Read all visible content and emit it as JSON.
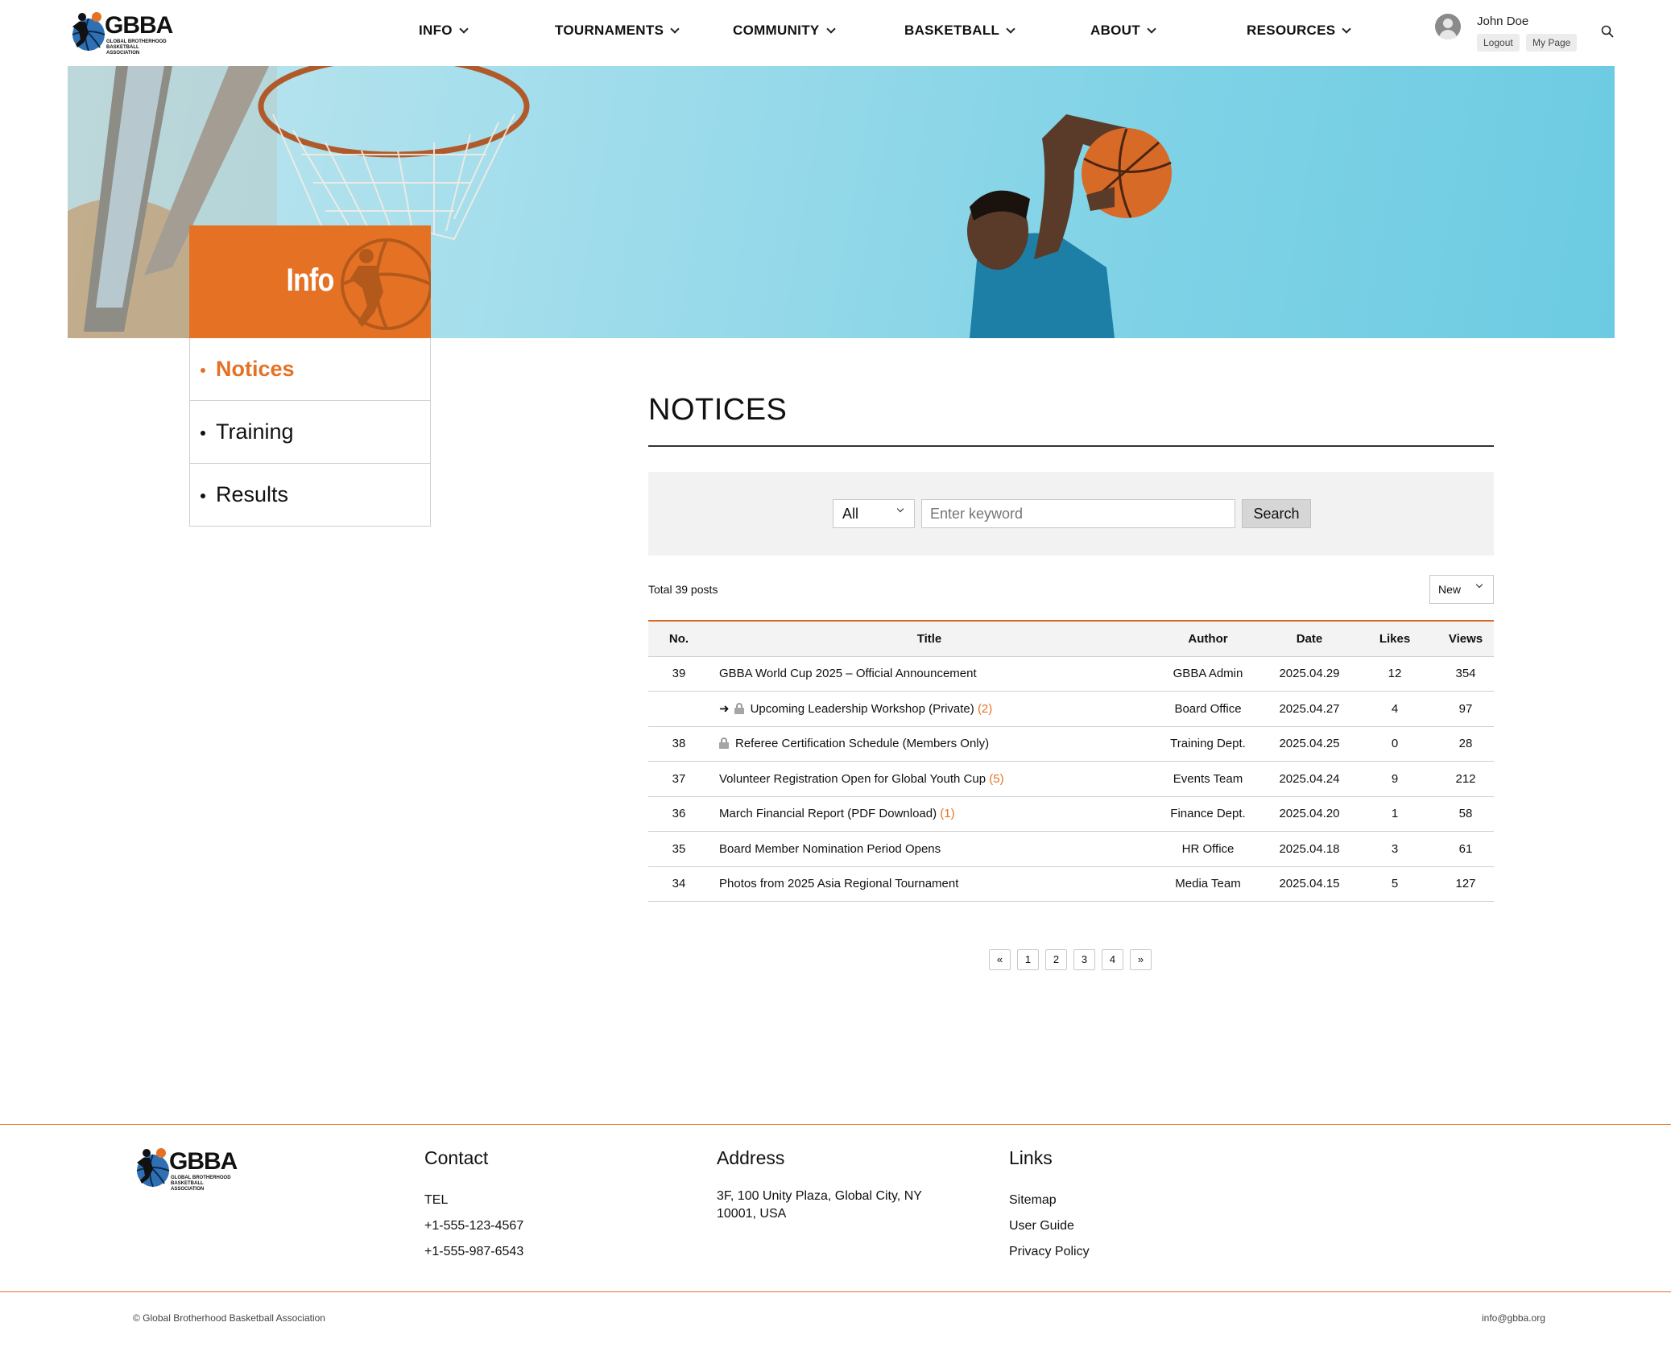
{
  "brand": {
    "logo_text": "GBBA",
    "logo_subtitle": "GLOBAL BROTHERHOOD BASKETBALL ASSOCIATION"
  },
  "nav": {
    "items": [
      {
        "label": "INFO"
      },
      {
        "label": "TOURNAMENTS"
      },
      {
        "label": "COMMUNITY"
      },
      {
        "label": "BASKETBALL"
      },
      {
        "label": "ABOUT"
      },
      {
        "label": "RESOURCES"
      }
    ]
  },
  "user": {
    "name": "John Doe",
    "logout_label": "Logout",
    "mypage_label": "My Page"
  },
  "hero": {
    "section_title": "Info"
  },
  "side_menu": {
    "items": [
      {
        "label": "Notices",
        "active": true
      },
      {
        "label": "Training",
        "active": false
      },
      {
        "label": "Results",
        "active": false
      }
    ]
  },
  "main": {
    "title": "NOTICES",
    "search": {
      "filter_value": "All",
      "keyword_placeholder": "Enter keyword",
      "button_label": "Search"
    },
    "total_text": "Total 39 posts",
    "sort_value": "New",
    "table": {
      "headers": {
        "no": "No.",
        "title": "Title",
        "author": "Author",
        "date": "Date",
        "likes": "Likes",
        "views": "Views"
      },
      "rows": [
        {
          "no": "39",
          "title": "GBBA World Cup 2025 – Official Announcement",
          "comments": "",
          "author": "GBBA Admin",
          "date": "2025.04.29",
          "likes": "12",
          "views": "354",
          "reply": false,
          "locked": false
        },
        {
          "no": "",
          "title": "Upcoming Leadership Workshop (Private)",
          "comments": "(2)",
          "author": "Board Office",
          "date": "2025.04.27",
          "likes": "4",
          "views": "97",
          "reply": true,
          "locked": true
        },
        {
          "no": "38",
          "title": "Referee Certification Schedule (Members Only)",
          "comments": "",
          "author": "Training Dept.",
          "date": "2025.04.25",
          "likes": "0",
          "views": "28",
          "reply": false,
          "locked": true
        },
        {
          "no": "37",
          "title": "Volunteer Registration Open for Global Youth Cup",
          "comments": "(5)",
          "author": "Events Team",
          "date": "2025.04.24",
          "likes": "9",
          "views": "212",
          "reply": false,
          "locked": false
        },
        {
          "no": "36",
          "title": "March Financial Report (PDF Download)",
          "comments": "(1)",
          "author": "Finance Dept.",
          "date": "2025.04.20",
          "likes": "1",
          "views": "58",
          "reply": false,
          "locked": false
        },
        {
          "no": "35",
          "title": "Board Member Nomination Period Opens",
          "comments": "",
          "author": "HR Office",
          "date": "2025.04.18",
          "likes": "3",
          "views": "61",
          "reply": false,
          "locked": false
        },
        {
          "no": "34",
          "title": "Photos from 2025 Asia Regional Tournament",
          "comments": "",
          "author": "Media Team",
          "date": "2025.04.15",
          "likes": "5",
          "views": "127",
          "reply": false,
          "locked": false
        }
      ]
    },
    "pagination": {
      "first": "«",
      "pages": [
        "1",
        "2",
        "3",
        "4"
      ],
      "last": "»"
    }
  },
  "footer": {
    "contact": {
      "heading": "Contact",
      "tel_label": "TEL",
      "phones": [
        "+1-555-123-4567",
        "+1-555-987-6543"
      ]
    },
    "address": {
      "heading": "Address",
      "text": "3F, 100 Unity Plaza, Global City, NY 10001, USA"
    },
    "links": {
      "heading": "Links",
      "items": [
        "Sitemap",
        "User Guide",
        "Privacy Policy"
      ]
    },
    "copyright": "© Global Brotherhood Basketball Association",
    "email": "info@gbba.org"
  },
  "colors": {
    "accent": "#e57224",
    "sky": "#7fd2e6"
  }
}
